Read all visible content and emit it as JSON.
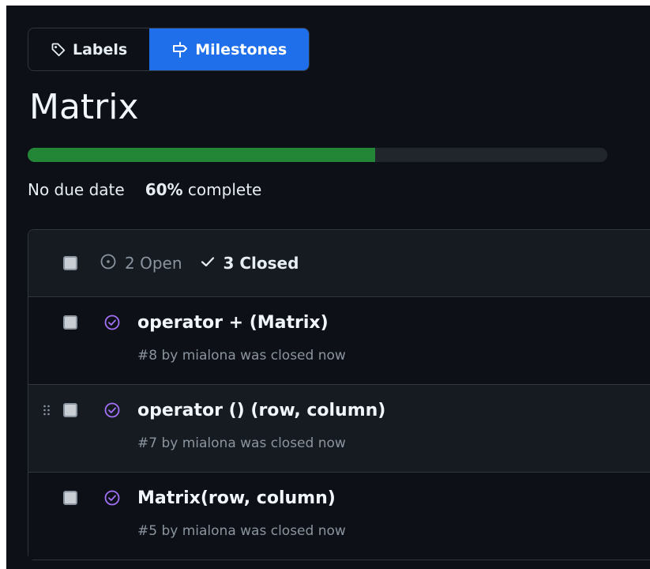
{
  "nav": {
    "labels_tab": "Labels",
    "milestones_tab": "Milestones"
  },
  "milestone": {
    "title": "Matrix",
    "progress_percent": 60,
    "due": "No due date",
    "percent_label": "60%",
    "complete_label": "complete"
  },
  "filters": {
    "open_label": "2 Open",
    "closed_label": "3 Closed"
  },
  "issues": [
    {
      "title": "operator + (Matrix)",
      "meta": "#8 by mialona was closed now"
    },
    {
      "title": "operator () (row, column)",
      "meta": "#7 by mialona was closed now"
    },
    {
      "title": "Matrix(row, column)",
      "meta": "#5 by mialona was closed now"
    }
  ],
  "colors": {
    "accent": "#1f6feb",
    "progress": "#238636",
    "closed_status": "#a371f7",
    "background": "#0d1117"
  },
  "icons": {
    "labels_tab": "tag-icon",
    "milestones_tab": "milestone-icon",
    "open_filter": "issue-opened-icon",
    "closed_filter": "check-icon",
    "issue_status": "issue-closed-icon",
    "drag": "grabber-icon"
  }
}
